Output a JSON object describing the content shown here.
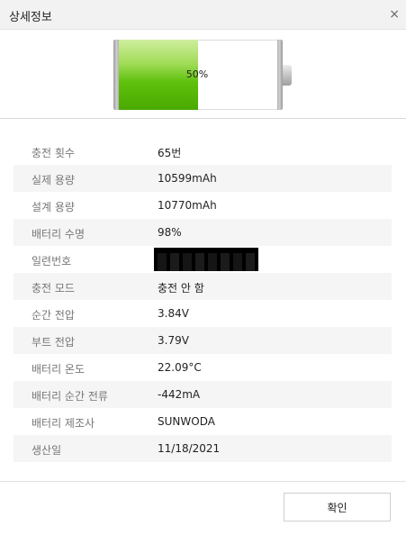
{
  "window": {
    "title": "상세정보",
    "close_symbol": "×"
  },
  "battery": {
    "percent_label": "50%",
    "level_fraction": 0.5,
    "fill_color": "#5fc10d"
  },
  "details": [
    {
      "label": "충전 횟수",
      "value": "65번"
    },
    {
      "label": "실제 용량",
      "value": "10599mAh"
    },
    {
      "label": "설계 용량",
      "value": "10770mAh"
    },
    {
      "label": "배터리 수명",
      "value": "98%"
    },
    {
      "label": "일련번호",
      "value": ""
    },
    {
      "label": "충전 모드",
      "value": "충전 안 함"
    },
    {
      "label": "순간 전압",
      "value": "3.84V"
    },
    {
      "label": "부트 전압",
      "value": "3.79V"
    },
    {
      "label": "배터리 온도",
      "value": "22.09°C"
    },
    {
      "label": "배터리 순간 전류",
      "value": "-442mA"
    },
    {
      "label": "배터리 제조사",
      "value": "SUNWODA"
    },
    {
      "label": "생산일",
      "value": "11/18/2021"
    }
  ],
  "footer": {
    "confirm_label": "확인"
  }
}
